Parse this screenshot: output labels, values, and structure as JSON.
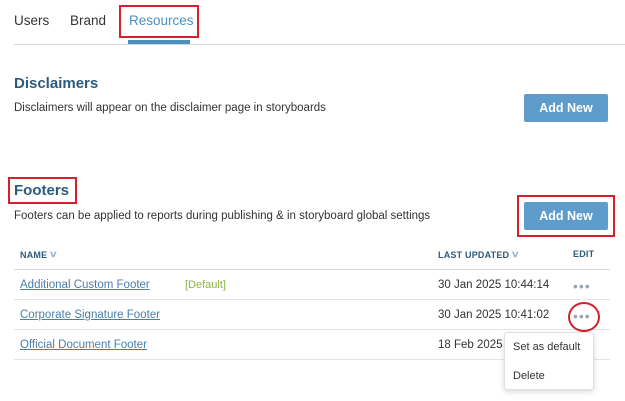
{
  "tabs": [
    {
      "label": "Users"
    },
    {
      "label": "Brand"
    },
    {
      "label": "Resources",
      "active": true
    }
  ],
  "disclaimers": {
    "title": "Disclaimers",
    "description": "Disclaimers will appear on the disclaimer page in storyboards",
    "add_button": "Add New"
  },
  "footers": {
    "title": "Footers",
    "description": "Footers can be applied to reports during publishing & in storyboard global settings",
    "add_button": "Add New",
    "columns": {
      "name": "NAME",
      "last_updated": "LAST UPDATED",
      "edit": "EDIT"
    },
    "rows": [
      {
        "name": "Additional Custom Footer",
        "badge": "[Default]",
        "last_updated": "30 Jan 2025 10:44:14"
      },
      {
        "name": "Corporate Signature Footer",
        "badge": "",
        "last_updated": "30 Jan 2025 10:41:02"
      },
      {
        "name": "Official Document Footer",
        "badge": "",
        "last_updated": "18 Feb 2025 C"
      }
    ],
    "row_menu": {
      "set_default": "Set as default",
      "delete": "Delete"
    }
  },
  "colors": {
    "accent": "#4a90c0",
    "button": "#5e9ccb",
    "heading": "#2c5b7c",
    "default_badge": "#8cb53f",
    "highlight": "#d6202e"
  },
  "icons": {
    "sort": "chevron-down-icon",
    "more": "more-horizontal-icon"
  }
}
